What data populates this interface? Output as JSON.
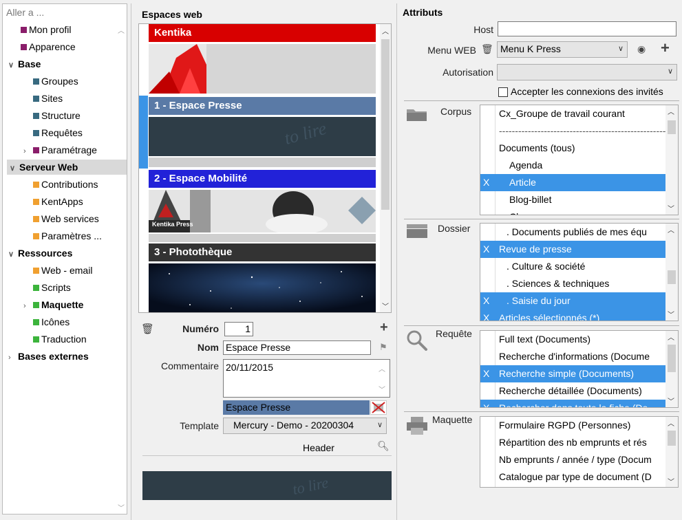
{
  "nav": {
    "search_placeholder": "Aller a ...",
    "items": [
      {
        "label": "Mon profil",
        "color": "#8a1d6a"
      },
      {
        "label": "Apparence",
        "color": "#8a1d6a"
      },
      {
        "label": "Base",
        "color": ""
      },
      {
        "label": "Groupes",
        "color": "#386a80"
      },
      {
        "label": "Sites",
        "color": "#386a80"
      },
      {
        "label": "Structure",
        "color": "#386a80"
      },
      {
        "label": "Requêtes",
        "color": "#386a80"
      },
      {
        "label": "Paramétrage",
        "color": "#8a1d6a"
      },
      {
        "label": "Serveur Web",
        "color": ""
      },
      {
        "label": "Contributions",
        "color": "#f0a030"
      },
      {
        "label": "KentApps",
        "color": "#f0a030"
      },
      {
        "label": "Web services",
        "color": "#f0a030"
      },
      {
        "label": "Paramètres ...",
        "color": "#f0a030"
      },
      {
        "label": "Ressources",
        "color": ""
      },
      {
        "label": "Web - email",
        "color": "#f0a030"
      },
      {
        "label": "Scripts",
        "color": "#3cb43c"
      },
      {
        "label": "Maquette",
        "color": "#3cb43c"
      },
      {
        "label": "Icônes",
        "color": "#3cb43c"
      },
      {
        "label": "Traduction",
        "color": "#3cb43c"
      },
      {
        "label": "Bases externes",
        "color": ""
      }
    ]
  },
  "sites": {
    "title": "Espaces web",
    "list": [
      {
        "label": "Kentika",
        "color": "#d00000"
      },
      {
        "label": "1 - Espace Presse",
        "color": "#5a7aa6"
      },
      {
        "label": "2 - Espace Mobilité",
        "color": "#2020d0"
      },
      {
        "label": "3 - Photothèque",
        "color": "#333333"
      }
    ],
    "image_text": "Kentika Press"
  },
  "form": {
    "numero_label": "Numéro",
    "numero_value": "1",
    "nom_label": "Nom",
    "nom_value": "Espace Presse",
    "commentaire_label": "Commentaire",
    "commentaire_value": "20/11/2015",
    "color_name": "Espace Presse",
    "template_label": "Template",
    "template_value": "Mercury - Demo - 20200304",
    "header_label": "Header"
  },
  "attributes": {
    "title": "Attributs",
    "host_label": "Host",
    "host_value": "",
    "menu_label": "Menu WEB",
    "menu_value": "Menu K Press",
    "autorisation_label": "Autorisation",
    "autorisation_value": "",
    "guest_label": "Accepter les connexions des invités",
    "guest_checked": false
  },
  "corpus": {
    "label": "Corpus",
    "rows": [
      {
        "x": "",
        "text": "Cx_Groupe de travail courant",
        "sel": false
      },
      {
        "x": "",
        "text": "----------------------------------------------------",
        "sel": false
      },
      {
        "x": "",
        "text": "Documents (tous)",
        "sel": false
      },
      {
        "x": "",
        "text": "Agenda",
        "sel": false
      },
      {
        "x": "X",
        "text": "Article",
        "sel": true
      },
      {
        "x": "",
        "text": "Blog-billet",
        "sel": false
      },
      {
        "x": "",
        "text": "Classeur",
        "sel": false
      }
    ]
  },
  "dossier": {
    "label": "Dossier",
    "rows": [
      {
        "x": "",
        "text": ". Documents publiés de mes équ",
        "sel": false
      },
      {
        "x": "X",
        "text": "Revue de presse",
        "sel": true
      },
      {
        "x": "",
        "text": ". Culture & société",
        "sel": false
      },
      {
        "x": "",
        "text": ". Sciences & techniques",
        "sel": false
      },
      {
        "x": "X",
        "text": ". Saisie du jour",
        "sel": true
      },
      {
        "x": "X",
        "text": "Articles sélectionnés (*)",
        "sel": true
      }
    ]
  },
  "requete": {
    "label": "Requête",
    "rows": [
      {
        "x": "",
        "text": "Full text (Documents)",
        "sel": false
      },
      {
        "x": "",
        "text": "Recherche d'informations (Docume",
        "sel": false
      },
      {
        "x": "X",
        "text": "Recherche simple (Documents)",
        "sel": true
      },
      {
        "x": "",
        "text": "Recherche détaillée (Documents)",
        "sel": false
      },
      {
        "x": "X",
        "text": "Rechercher dans toute la fiche (Do",
        "sel": true
      }
    ]
  },
  "maquette": {
    "label": "Maquette",
    "rows": [
      {
        "x": "",
        "text": "Formulaire RGPD (Personnes)",
        "sel": false
      },
      {
        "x": "",
        "text": "Répartition des nb emprunts et rés",
        "sel": false
      },
      {
        "x": "",
        "text": "Nb emprunts / année / type (Docum",
        "sel": false
      },
      {
        "x": "",
        "text": "Catalogue par type de document (D",
        "sel": false
      }
    ]
  }
}
